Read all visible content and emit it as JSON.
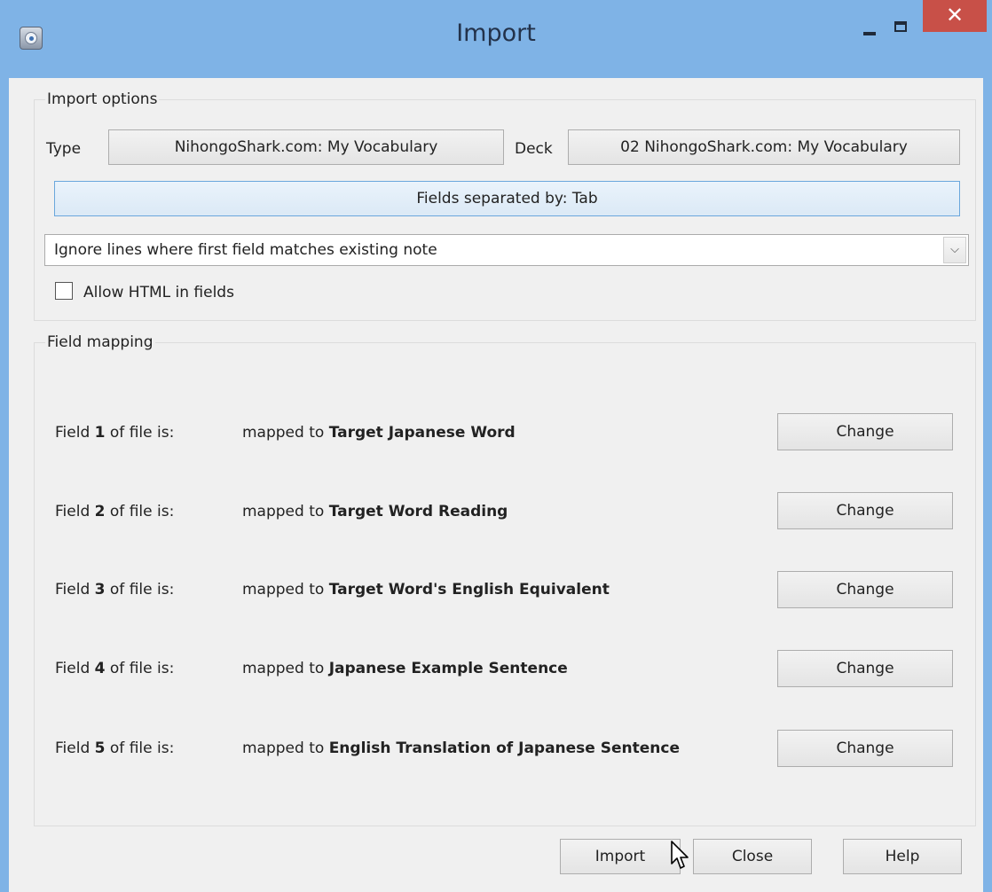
{
  "window": {
    "title": "Import",
    "minimize_label": "",
    "maximize_label": "",
    "close_label": "✕"
  },
  "import_options": {
    "title": "Import options",
    "type_label": "Type",
    "type_value": "NihongoShark.com: My Vocabulary",
    "deck_label": "Deck",
    "deck_value": "02 NihongoShark.com: My Vocabulary",
    "separator_button": "Fields separated by: Tab",
    "duplicate_mode": "Ignore lines where first field matches existing note",
    "allow_html_label": "Allow HTML in fields",
    "allow_html_checked": false
  },
  "field_mapping": {
    "title": "Field mapping",
    "row_prefix": "Field ",
    "row_suffix": " of file is:",
    "mapped_prefix": "mapped to ",
    "change_label": "Change",
    "rows": [
      {
        "number": "1",
        "target": "Target Japanese Word"
      },
      {
        "number": "2",
        "target": "Target Word Reading"
      },
      {
        "number": "3",
        "target": "Target Word's English Equivalent"
      },
      {
        "number": "4",
        "target": "Japanese Example Sentence"
      },
      {
        "number": "5",
        "target": "English Translation of Japanese Sentence"
      }
    ]
  },
  "buttons": {
    "import": "Import",
    "close": "Close",
    "help": "Help"
  },
  "colors": {
    "title_bar": "#7fb3e6",
    "close_button": "#c85048",
    "dialog_background": "#f0f0f0"
  }
}
